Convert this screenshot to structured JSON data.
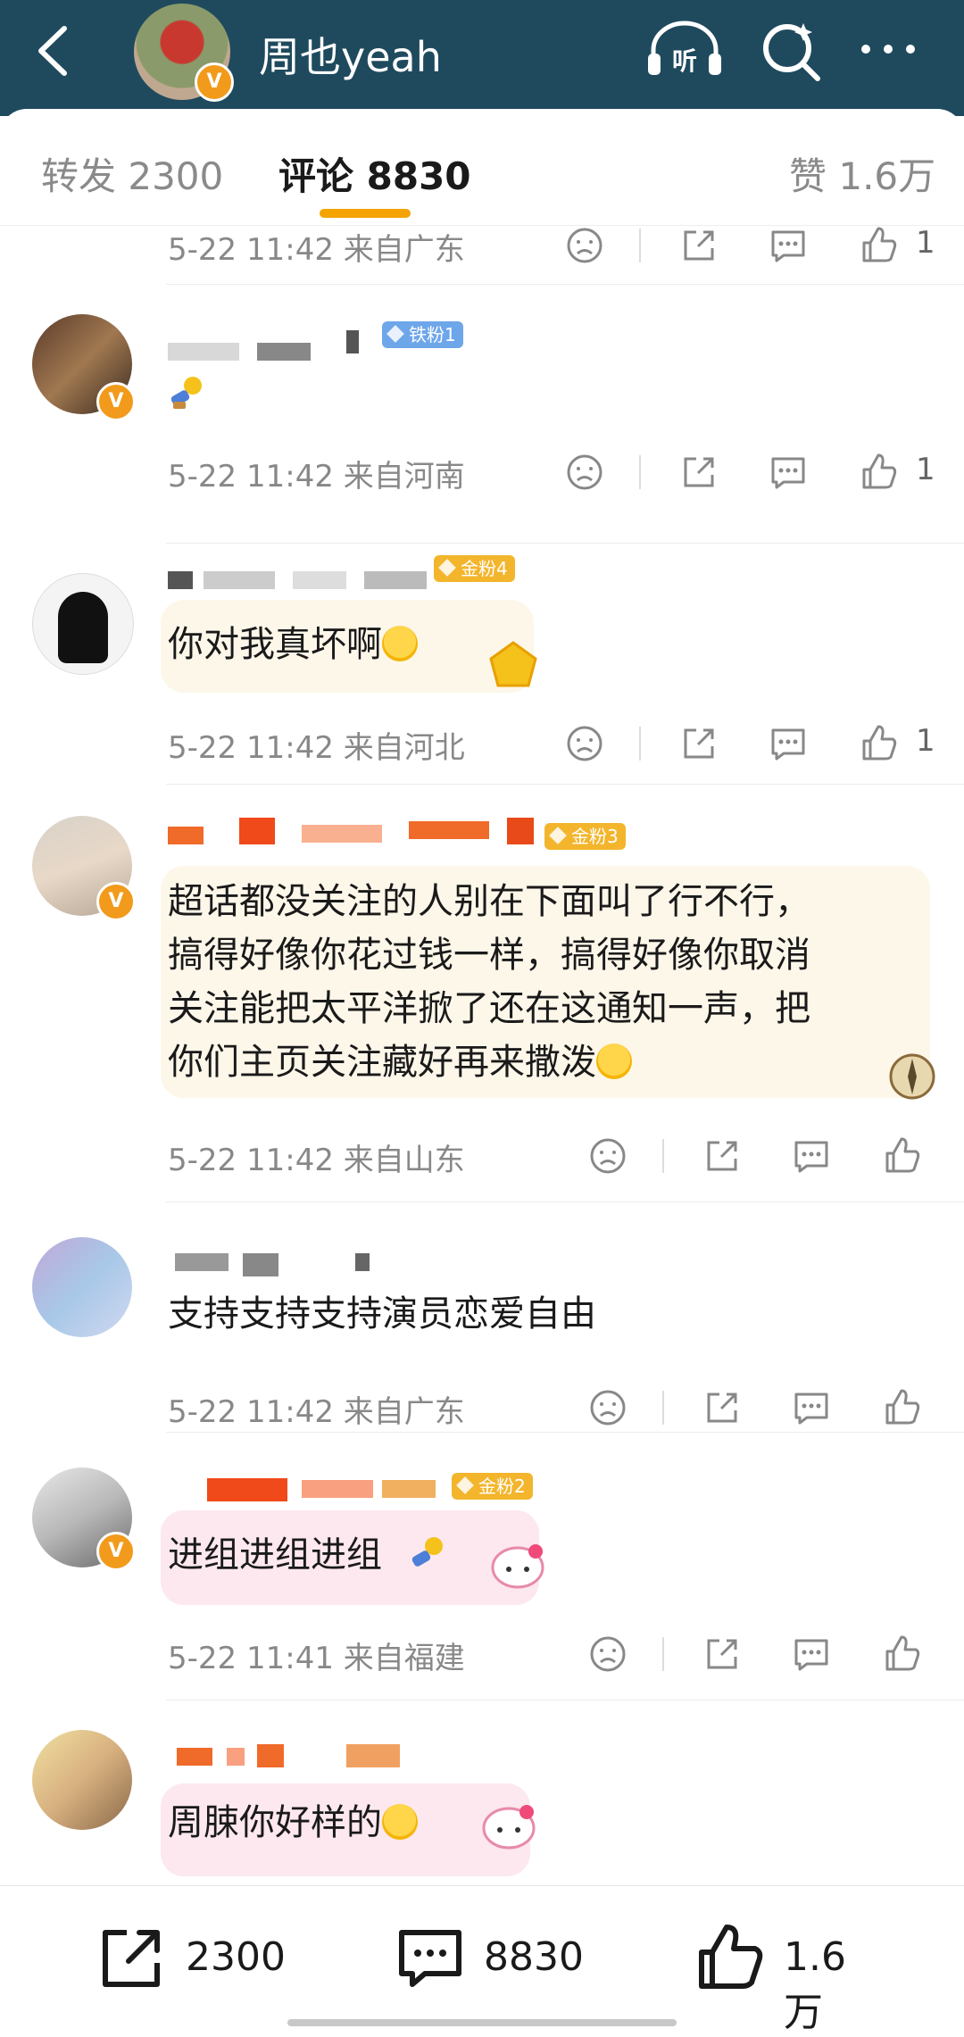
{
  "header": {
    "username": "周也yeah",
    "icons": [
      "back-arrow-icon",
      "listen-icon",
      "search-icon",
      "more-icon"
    ],
    "listen_label": "听",
    "verified_label": "V"
  },
  "tabs": [
    {
      "label": "转发 2300"
    },
    {
      "label": "评论 8830",
      "active": true
    },
    {
      "label": "赞 1.6万"
    }
  ],
  "comments": [
    {
      "meta": "5-22 11:42  来自广东",
      "likes": "1"
    },
    {
      "badge": "铁粉1",
      "text": "",
      "meta": "5-22 11:42  来自河南",
      "likes": "1"
    },
    {
      "badge": "金粉4",
      "text": "你对我真坏啊",
      "meta": "5-22 11:42  来自河北",
      "likes": "1"
    },
    {
      "badge": "金粉3",
      "text_lines": [
        "超话都没关注的人别在下面叫了行不行，",
        "搞得好像你花过钱一样，搞得好像你取消",
        "关注能把太平洋掀了还在这通知一声，把",
        "你们主页关注藏好再来撒泼"
      ],
      "meta": "5-22 11:42  来自山东",
      "likes": ""
    },
    {
      "text": "支持支持支持演员恋爱自由",
      "meta": "5-22 11:42  来自广东",
      "likes": ""
    },
    {
      "badge": "金粉2",
      "text": "进组进组进组",
      "meta": "5-22 11:41  来自福建",
      "likes": ""
    },
    {
      "text": "周脨你好样的",
      "likes": ""
    }
  ],
  "bottom_bar": {
    "repost_count": "2300",
    "comment_count": "8830",
    "like_count": "1.6万"
  },
  "colors": {
    "header_bg": "#1f4a5e",
    "accent": "#f4a300",
    "iron_fan": "#6ea6ea",
    "gold_fan": "#f3b52c",
    "verified": "#f29a1b"
  }
}
